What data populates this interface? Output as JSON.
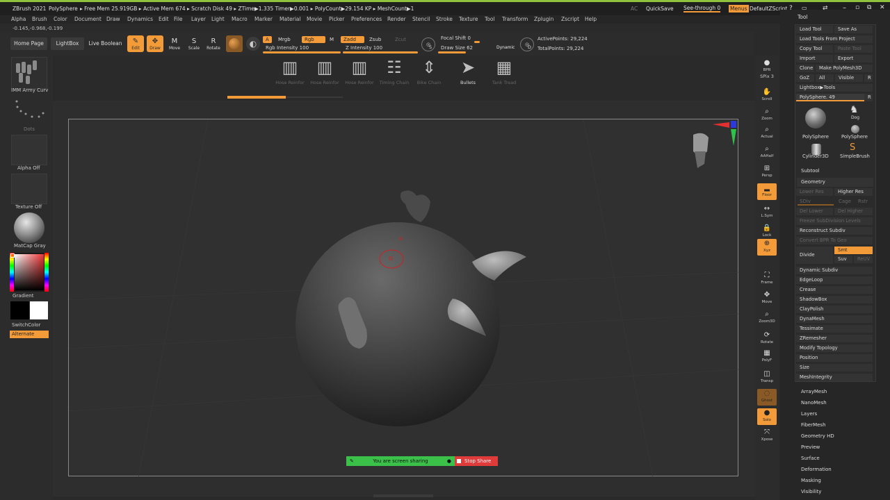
{
  "titlebar": {
    "app": "ZBrush 2021",
    "tool": "PolySphere",
    "stats": "▸ Free Mem 25.919GB ▸ Active Mem 674 ▸ Scratch Disk 49 ▸ ZTime▶1.335 Timer▶0.001 ▸ PolyCount▶29.154 KP ▸ MeshCount▶1",
    "ac": "AC",
    "quicksave": "QuickSave",
    "seethrough": "See-through 0",
    "menus": "Menus",
    "defaultzscript": "DefaultZScript",
    "tool_label": "Tool"
  },
  "menubar": [
    "Alpha",
    "Brush",
    "Color",
    "Document",
    "Draw",
    "Dynamics",
    "Edit",
    "File",
    "Layer",
    "Light",
    "Macro",
    "Marker",
    "Material",
    "Movie",
    "Picker",
    "Preferences",
    "Render",
    "Stencil",
    "Stroke",
    "Texture",
    "Tool",
    "Transform",
    "Zplugin",
    "Zscript",
    "Help"
  ],
  "coords": "-0.145,-0.968,-0.199",
  "toolbar": {
    "home_page": "Home Page",
    "lightbox": "LightBox",
    "live_boolean": "Live Boolean",
    "edit": "Edit",
    "draw": "Draw",
    "move": "Move",
    "scale": "Scale",
    "rotate": "Rotate",
    "a": "A",
    "mrgb": "Mrgb",
    "rgb": "Rgb",
    "m": "M",
    "zadd": "Zadd",
    "zsub": "Zsub",
    "zcut": "Zcut",
    "rgb_intensity": "Rgb Intensity 100",
    "z_intensity": "Z Intensity 100",
    "focal_shift": "Focal Shift 0",
    "draw_size": "Draw Size 62",
    "dynamic": "Dynamic",
    "active_points": "ActivePoints: 29,224",
    "total_points": "TotalPoints: 29,224",
    "s": "S",
    "d": "D"
  },
  "shelf": [
    {
      "name": "Hose Reinfor"
    },
    {
      "name": "Hose Reinfor"
    },
    {
      "name": "Hose Reinfor"
    },
    {
      "name": "Timing Chain"
    },
    {
      "name": "Bike Chain"
    },
    {
      "name": "Bullets"
    },
    {
      "name": "Tank Tread"
    }
  ],
  "leftpanel": {
    "brush": "IMM Army Curv",
    "stroke": "Dots",
    "alpha": "Alpha Off",
    "texture": "Texture Off",
    "material": "MatCap Gray",
    "gradient": "Gradient",
    "switchcolor": "SwitchColor",
    "alternate": "Alternate"
  },
  "rstrip": [
    {
      "label": "BPR",
      "icon": "bpr-icon"
    },
    {
      "label": "SPix 3",
      "icon": "spix-icon"
    },
    {
      "label": "Scroll",
      "icon": "scroll-icon"
    },
    {
      "label": "Zoom",
      "icon": "zoom-icon"
    },
    {
      "label": "Actual",
      "icon": "actual-icon"
    },
    {
      "label": "AAHalf",
      "icon": "aahalf-icon"
    },
    {
      "label": "Persp",
      "icon": "persp-icon"
    },
    {
      "label": "Floor",
      "icon": "floor-icon"
    },
    {
      "label": "L.Sym",
      "icon": "lsym-icon"
    },
    {
      "label": "Lock",
      "icon": "lock-icon"
    },
    {
      "label": "Xyz",
      "icon": "xyz-icon"
    },
    {
      "label": "Frame",
      "icon": "frame-icon"
    },
    {
      "label": "Move",
      "icon": "move-icon"
    },
    {
      "label": "Zoom3D",
      "icon": "zoom3d-icon"
    },
    {
      "label": "Rotate",
      "icon": "rotate-icon"
    },
    {
      "label": "PolyF",
      "icon": "polyf-icon"
    },
    {
      "label": "Transp",
      "icon": "transp-icon"
    },
    {
      "label": "Ghost",
      "icon": "ghost-icon"
    },
    {
      "label": "Solo",
      "icon": "solo-icon"
    },
    {
      "label": "Xpose",
      "icon": "xpose-icon"
    }
  ],
  "toolpanel": {
    "load_tool": "Load Tool",
    "save_as": "Save As",
    "load_from_project": "Load Tools From Project",
    "copy_tool": "Copy Tool",
    "paste_tool": "Paste Tool",
    "import": "Import",
    "export": "Export",
    "clone": "Clone",
    "make_polymesh": "Make PolyMesh3D",
    "goz": "GoZ",
    "all": "All",
    "visible": "Visible",
    "r": "R",
    "lightbox_tools": "Lightbox▶Tools",
    "polysphere_slider": "PolySphere. 49",
    "r2": "R",
    "tools": [
      "PolySphere",
      "PolySphere",
      "Cylinder3D",
      "SimpleBrush"
    ],
    "dog": "Dog",
    "subtool": "Subtool",
    "geometry": "Geometry",
    "lower_res": "Lower Res",
    "higher_res": "Higher Res",
    "sdiv": "SDiv",
    "cage": "Cage",
    "rstr": "Rstr",
    "del_lower": "Del Lower",
    "del_higher": "Del Higher",
    "freeze_subdiv": "Freeze SubDivision Levels",
    "reconstruct_subdiv": "Reconstruct Subdiv",
    "convert_bpr": "Convert BPR To Geo",
    "divide": "Divide",
    "smt": "Smt",
    "suv": "Suv",
    "reuv": "ReUV",
    "geo_items": [
      "Dynamic Subdiv",
      "EdgeLoop",
      "Crease",
      "ShadowBox",
      "ClayPolish",
      "DynaMesh",
      "Tessimate",
      "ZRemesher",
      "Modify Topology",
      "Position",
      "Size",
      "MeshIntegrity"
    ],
    "sections": [
      "ArrayMesh",
      "NanoMesh",
      "Layers",
      "FiberMesh",
      "Geometry HD",
      "Preview",
      "Surface",
      "Deformation",
      "Masking",
      "Visibility"
    ]
  },
  "share": {
    "sharing": "You are screen sharing",
    "stop": "Stop Share"
  },
  "colors": {
    "accent": "#f29b38",
    "share_green": "#3bc14a",
    "share_red": "#e03b3b",
    "titlebar_green": "#8ec23c"
  }
}
